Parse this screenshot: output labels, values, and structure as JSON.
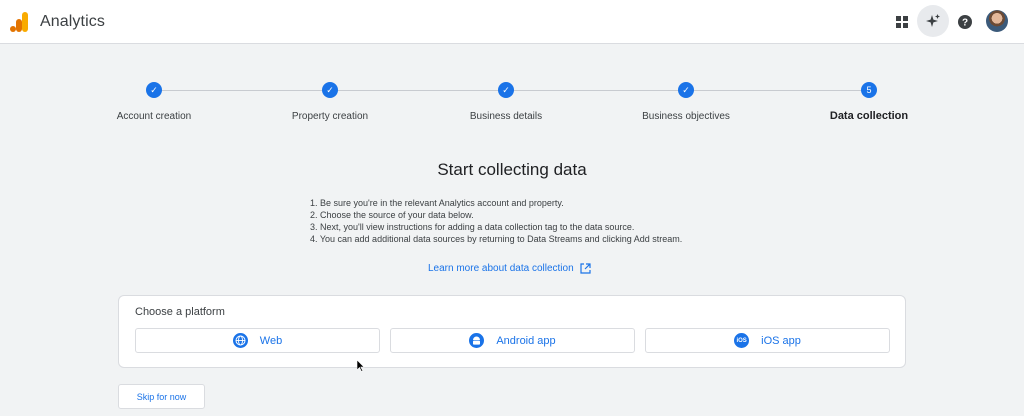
{
  "header": {
    "app_title": "Analytics",
    "icons": [
      "analytics-logo-icon",
      "apps-grid-icon",
      "sparkle-icon",
      "help-icon",
      "avatar"
    ]
  },
  "stepper": {
    "steps": [
      {
        "label": "Account creation",
        "marker": "✓",
        "state": "complete"
      },
      {
        "label": "Property creation",
        "marker": "✓",
        "state": "complete"
      },
      {
        "label": "Business details",
        "marker": "✓",
        "state": "complete"
      },
      {
        "label": "Business objectives",
        "marker": "✓",
        "state": "complete"
      },
      {
        "label": "Data collection",
        "marker": "5",
        "state": "current"
      }
    ]
  },
  "main": {
    "heading": "Start collecting data",
    "instructions": [
      "1. Be sure you're in the relevant Analytics account and property.",
      "2. Choose the source of your data below.",
      "3. Next, you'll view instructions for adding a data collection tag to the data source.",
      "4. You can add additional data sources by returning to Data Streams and clicking Add stream."
    ],
    "learn_more": "Learn more about data collection"
  },
  "platform": {
    "title": "Choose a platform",
    "options": [
      {
        "label": "Web",
        "icon": "globe-icon"
      },
      {
        "label": "Android app",
        "icon": "android-icon"
      },
      {
        "label": "iOS app",
        "icon": "ios-icon",
        "icon_text": "iOS"
      }
    ]
  },
  "footer": {
    "skip_label": "Skip for now"
  },
  "colors": {
    "accent": "#1a73e8",
    "logo_orange": "#f9ab00",
    "logo_dark_orange": "#e37400",
    "background": "#f1f3f4"
  }
}
